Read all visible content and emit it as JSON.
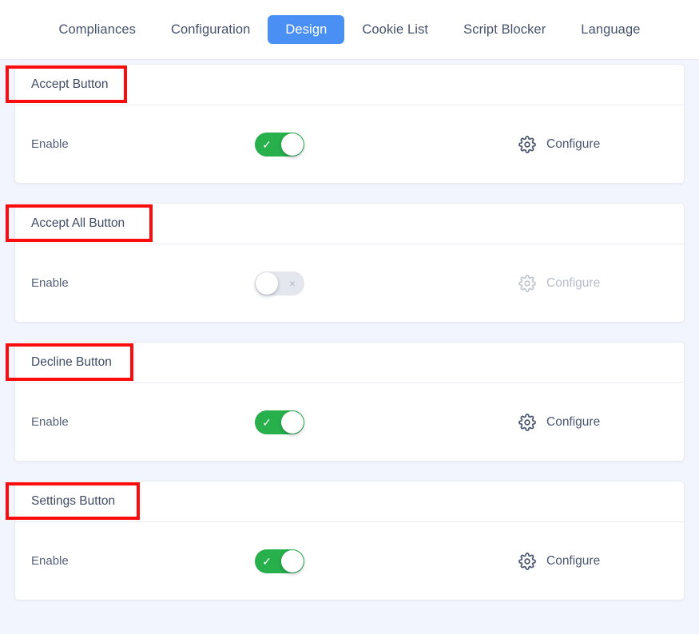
{
  "theme": {
    "page_background": "#f2f5fd",
    "card_background": "#ffffff",
    "accent_blue": "#4a90f4",
    "toggle_on_green": "#27b04b",
    "toggle_off_gray": "#e4e7ed",
    "annotation_red": "#fc0d0d",
    "text_primary": "#3f4b63",
    "text_muted": "#b7bcc9"
  },
  "nav": {
    "tabs": [
      {
        "label": "Compliances",
        "active": false
      },
      {
        "label": "Configuration",
        "active": false
      },
      {
        "label": "Design",
        "active": true
      },
      {
        "label": "Cookie List",
        "active": false
      },
      {
        "label": "Script Blocker",
        "active": false
      },
      {
        "label": "Language",
        "active": false
      }
    ]
  },
  "sections": [
    {
      "title": "Accept Button",
      "row_label": "Enable",
      "toggle": {
        "state": "on",
        "glyph": "✓",
        "icon_name": "check-icon"
      },
      "configure": {
        "label": "Configure",
        "icon_name": "gear-icon",
        "disabled": false
      },
      "annotated": true
    },
    {
      "title": "Accept All Button",
      "row_label": "Enable",
      "toggle": {
        "state": "off",
        "glyph": "×",
        "icon_name": "cross-icon"
      },
      "configure": {
        "label": "Configure",
        "icon_name": "gear-icon",
        "disabled": true
      },
      "annotated": true
    },
    {
      "title": "Decline Button",
      "row_label": "Enable",
      "toggle": {
        "state": "on",
        "glyph": "✓",
        "icon_name": "check-icon"
      },
      "configure": {
        "label": "Configure",
        "icon_name": "gear-icon",
        "disabled": false
      },
      "annotated": true
    },
    {
      "title": "Settings Button",
      "row_label": "Enable",
      "toggle": {
        "state": "on",
        "glyph": "✓",
        "icon_name": "check-icon"
      },
      "configure": {
        "label": "Configure",
        "icon_name": "gear-icon",
        "disabled": false
      },
      "annotated": true
    }
  ]
}
